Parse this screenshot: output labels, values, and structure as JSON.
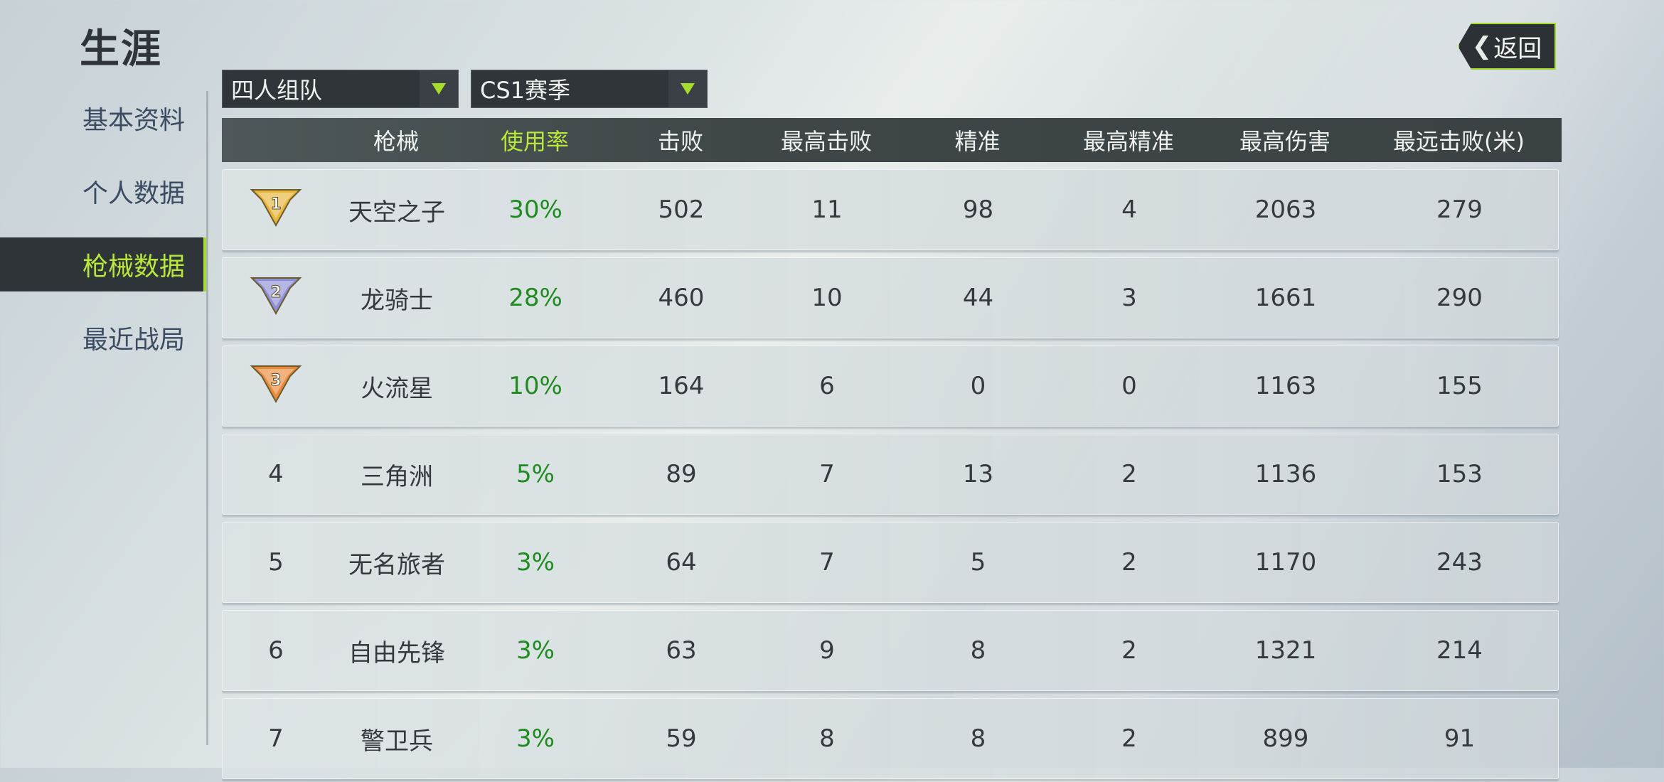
{
  "header": {
    "title": "生涯",
    "back_label": "返回"
  },
  "sidebar": {
    "items": [
      {
        "label": "基本资料",
        "active": false
      },
      {
        "label": "个人数据",
        "active": false
      },
      {
        "label": "枪械数据",
        "active": true
      },
      {
        "label": "最近战局",
        "active": false
      }
    ]
  },
  "filters": {
    "mode": "四人组队",
    "season": "CS1赛季"
  },
  "table": {
    "headers": [
      "",
      "枪械",
      "使用率",
      "击败",
      "最高击败",
      "精准",
      "最高精准",
      "最高伤害",
      "最远击败(米)"
    ],
    "rows": [
      {
        "rank": "1",
        "badge": "gold",
        "name": "天空之子",
        "rate": "30%",
        "kills": "502",
        "max_kills": "11",
        "accuracy": "98",
        "max_accuracy": "4",
        "max_damage": "2063",
        "farthest": "279"
      },
      {
        "rank": "2",
        "badge": "silver",
        "name": "龙骑士",
        "rate": "28%",
        "kills": "460",
        "max_kills": "10",
        "accuracy": "44",
        "max_accuracy": "3",
        "max_damage": "1661",
        "farthest": "290"
      },
      {
        "rank": "3",
        "badge": "bronze",
        "name": "火流星",
        "rate": "10%",
        "kills": "164",
        "max_kills": "6",
        "accuracy": "0",
        "max_accuracy": "0",
        "max_damage": "1163",
        "farthest": "155"
      },
      {
        "rank": "4",
        "badge": "",
        "name": "三角洲",
        "rate": "5%",
        "kills": "89",
        "max_kills": "7",
        "accuracy": "13",
        "max_accuracy": "2",
        "max_damage": "1136",
        "farthest": "153"
      },
      {
        "rank": "5",
        "badge": "",
        "name": "无名旅者",
        "rate": "3%",
        "kills": "64",
        "max_kills": "7",
        "accuracy": "5",
        "max_accuracy": "2",
        "max_damage": "1170",
        "farthest": "243"
      },
      {
        "rank": "6",
        "badge": "",
        "name": "自由先锋",
        "rate": "3%",
        "kills": "63",
        "max_kills": "9",
        "accuracy": "8",
        "max_accuracy": "2",
        "max_damage": "1321",
        "farthest": "214"
      },
      {
        "rank": "7",
        "badge": "",
        "name": "警卫兵",
        "rate": "3%",
        "kills": "59",
        "max_kills": "8",
        "accuracy": "8",
        "max_accuracy": "2",
        "max_damage": "899",
        "farthest": "91"
      }
    ]
  },
  "colors": {
    "accent": "#a6dd2a",
    "rate_text": "#1e8c1e",
    "gold": "#e7b53a",
    "silver": "#8d8fd6",
    "bronze": "#e88a3a"
  }
}
